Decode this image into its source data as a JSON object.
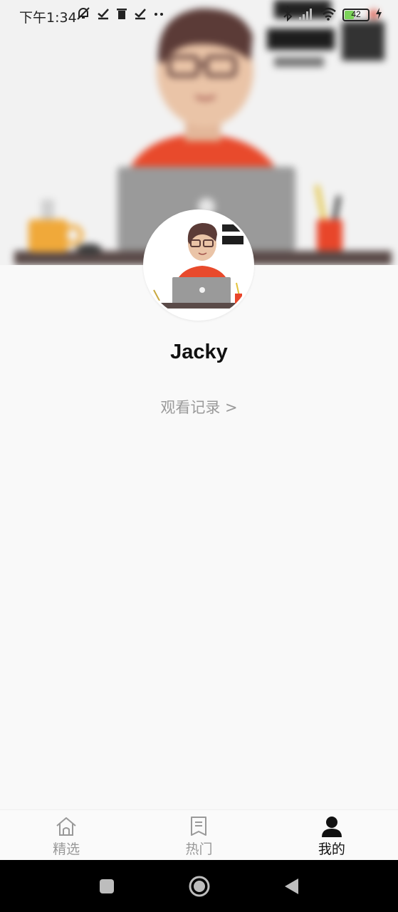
{
  "status_bar": {
    "time": "下午1:34",
    "battery_level": "42",
    "left_icons": [
      "mute-bell-icon",
      "check-icon",
      "trash-icon",
      "check-icon",
      "more-dots-icon"
    ],
    "right_icons": [
      "bluetooth-icon",
      "signal-icon",
      "wifi-icon",
      "battery-icon",
      "charging-icon"
    ]
  },
  "profile": {
    "username": "Jacky",
    "history_link": "观看记录 >"
  },
  "tabbar": {
    "tabs": [
      {
        "label": "精选",
        "icon": "home-icon",
        "active": false
      },
      {
        "label": "热门",
        "icon": "bookmark-icon",
        "active": false
      },
      {
        "label": "我的",
        "icon": "person-icon",
        "active": true
      }
    ]
  },
  "system_nav": {
    "icons": [
      "recents-square-icon",
      "home-circle-icon",
      "back-triangle-icon"
    ]
  },
  "colors": {
    "accent_active": "#111111",
    "inactive": "#999999",
    "battery": "#7cd35a",
    "shirt": "#e84a2c"
  }
}
